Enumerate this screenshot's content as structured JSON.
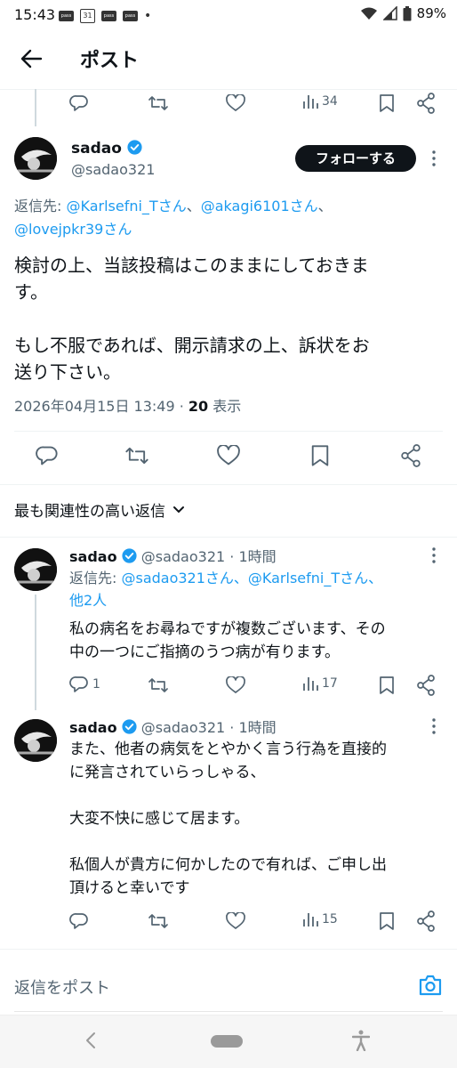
{
  "status_bar": {
    "time": "15:43",
    "calendar_day": "31",
    "pass_label": "pass",
    "dot": "•",
    "battery": "89%"
  },
  "header": {
    "title": "ポスト"
  },
  "prev_actions": {
    "views": "34"
  },
  "main_post": {
    "display_name": "sadao",
    "handle": "@sadao321",
    "follow_label": "フォローする",
    "reply_prefix": "返信先: ",
    "reply_to": [
      "@Karlsefni_Tさん",
      "@akagi6101さん",
      "@lovejpkr39さん"
    ],
    "separator": "、",
    "body_line1": "検討の上、当該投稿はこのままにしておきま",
    "body_line2": "す。",
    "body_line3": "もし不服であれば、開示請求の上、訴状をお",
    "body_line4": "送り下さい。",
    "timestamp": "2026年04月15日 13:49 · ",
    "views_count": "20",
    "views_label": " 表示"
  },
  "sort": {
    "label": "最も関連性の高い返信"
  },
  "reply1": {
    "display_name": "sadao",
    "handle": "@sadao321",
    "time": " · 1時間",
    "reply_prefix": "返信先: ",
    "reply_to_line1": "@sadao321さん、@Karlsefni_Tさん、",
    "reply_to_line2": "他2人",
    "body_line1": "私の病名をお尋ねですが複数ございます、その",
    "body_line2": "中の一つにご指摘のうつ病が有ります。",
    "replies": "1",
    "views": "17"
  },
  "reply2": {
    "display_name": "sadao",
    "handle": "@sadao321",
    "time": " · 1時間",
    "body_line1": "また、他者の病気をとやかく言う行為を直接的",
    "body_line2": "に発言されていらっしゃる、",
    "body_line3": "大変不快に感じて居ます。",
    "body_line4": "私個人が貴方に何かしたので有れば、ご申し出",
    "body_line5": "頂けると幸いです",
    "views": "15"
  },
  "compose": {
    "placeholder": "返信をポスト"
  },
  "colors": {
    "accent": "#1d9bf0",
    "text": "#0f1419",
    "muted": "#536471"
  }
}
